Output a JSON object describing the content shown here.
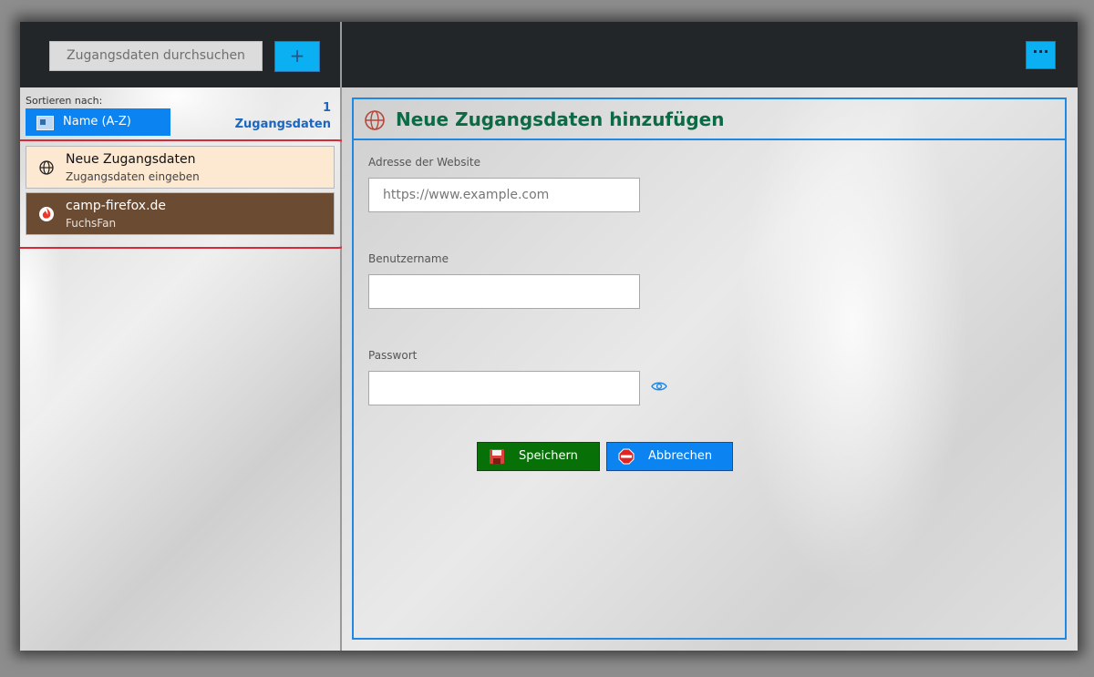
{
  "header": {
    "search_placeholder": "Zugangsdaten durchsuchen",
    "add_label": "+",
    "more_label": "···"
  },
  "sidebar": {
    "sort_label": "Sortieren nach:",
    "sort_value": "Name (A-Z)",
    "count_number": "1",
    "count_label": "Zugangsdaten",
    "items": [
      {
        "title": "Neue Zugangsdaten",
        "subtitle": "Zugangsdaten eingeben",
        "icon": "globe-icon"
      },
      {
        "title": "camp-firefox.de",
        "subtitle": "FuchsFan",
        "icon": "firefox-icon"
      }
    ]
  },
  "form": {
    "title": "Neue Zugangsdaten hinzufügen",
    "website_label": "Adresse der Website",
    "website_placeholder": "https://www.example.com",
    "username_label": "Benutzername",
    "username_value": "",
    "password_label": "Passwort",
    "password_value": "",
    "save_label": "Speichern",
    "cancel_label": "Abbrechen"
  },
  "colors": {
    "accent": "#0b84f2",
    "title_green": "#0a6b45",
    "save_green": "#077007",
    "highlight_red": "#d62a38",
    "selected_item_bg": "#6c4b33",
    "new_item_bg": "#fde8d1"
  }
}
